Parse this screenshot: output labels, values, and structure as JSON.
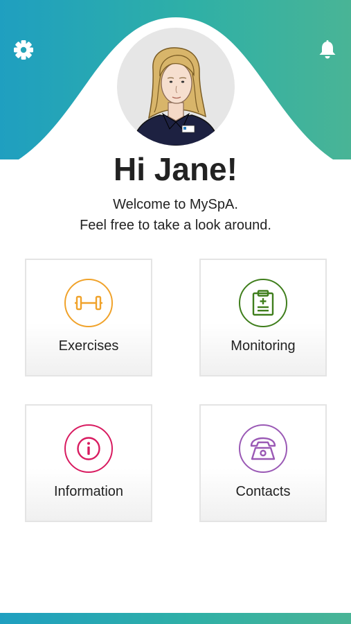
{
  "app": {
    "name": "MySpA"
  },
  "header": {
    "settings_icon": "gear-icon",
    "notifications_icon": "bell-icon"
  },
  "greeting": {
    "title": "Hi Jane!",
    "line1": "Welcome to MySpA.",
    "line2": "Feel free to take a look around."
  },
  "tiles": [
    {
      "label": "Exercises",
      "icon": "dumbbell-icon",
      "color": "#f0a22a"
    },
    {
      "label": "Monitoring",
      "icon": "clipboard-icon",
      "color": "#3f7e1c"
    },
    {
      "label": "Information",
      "icon": "info-icon",
      "color": "#d81b60"
    },
    {
      "label": "Contacts",
      "icon": "telephone-icon",
      "color": "#9a59b5"
    }
  ],
  "colors": {
    "gradient_start": "#1f9fc0",
    "gradient_end": "#49b496",
    "avatar_bg": "#e6e6e6"
  }
}
